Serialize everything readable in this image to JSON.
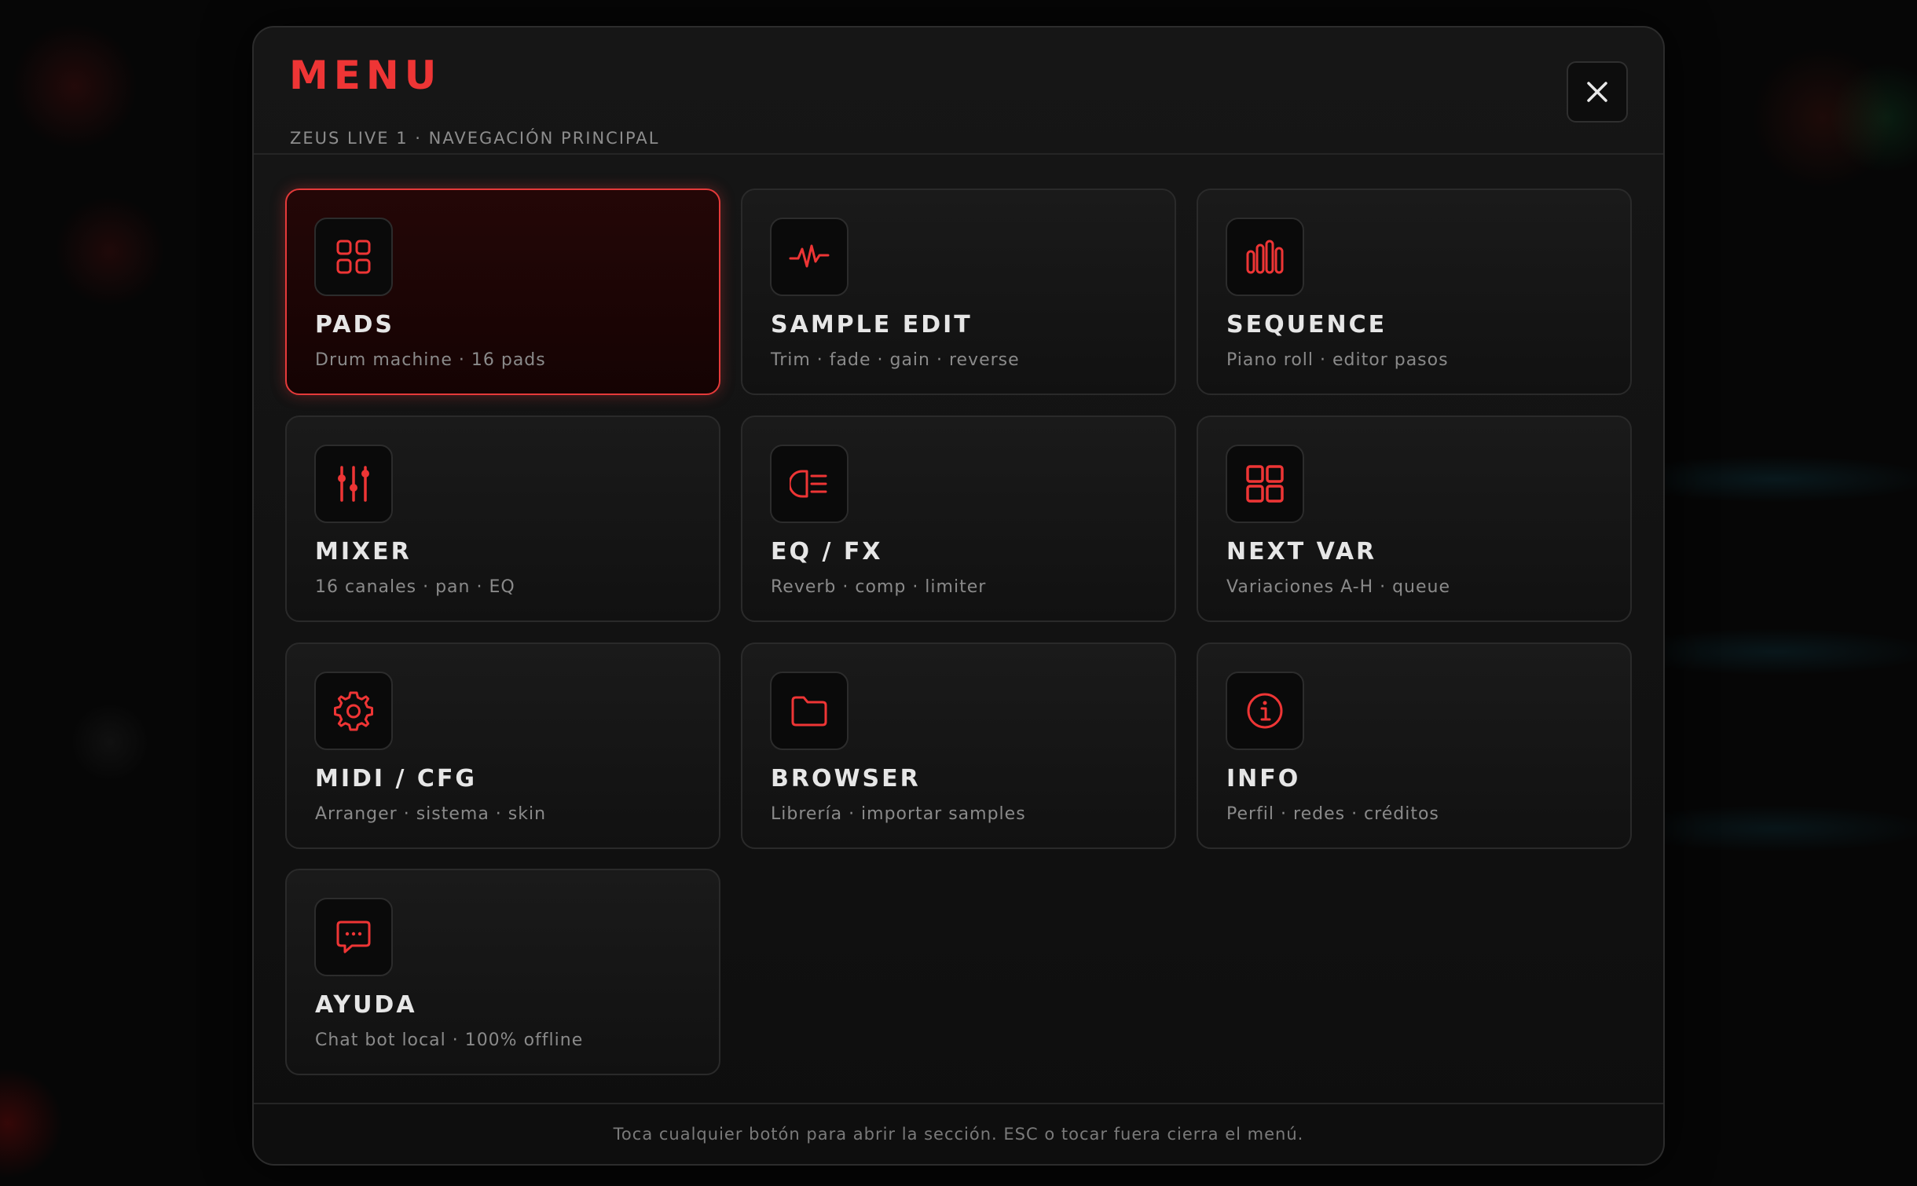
{
  "backdrop": {},
  "menu": {
    "title": "MENU",
    "subtitle": "ZEUS LIVE 1 · NAVEGACIÓN PRINCIPAL",
    "close_icon": "close-icon",
    "accent_color": "#ee3535",
    "items": [
      {
        "label": "PADS",
        "desc": "Drum machine · 16 pads",
        "icon": "grid-icon",
        "active": true
      },
      {
        "label": "SAMPLE EDIT",
        "desc": "Trim · fade · gain · reverse",
        "icon": "waveform-icon",
        "active": false
      },
      {
        "label": "SEQUENCE",
        "desc": "Piano roll · editor pasos",
        "icon": "bars-icon",
        "active": false
      },
      {
        "label": "MIXER",
        "desc": "16 canales · pan · EQ",
        "icon": "sliders-icon",
        "active": false
      },
      {
        "label": "EQ / FX",
        "desc": "Reverb · comp · limiter",
        "icon": "eq-fx-icon",
        "active": false
      },
      {
        "label": "NEXT VAR",
        "desc": "Variaciones A-H · queue",
        "icon": "layout-grid-icon",
        "active": false
      },
      {
        "label": "MIDI / CFG",
        "desc": "Arranger · sistema · skin",
        "icon": "gear-icon",
        "active": false
      },
      {
        "label": "BROWSER",
        "desc": "Librería · importar samples",
        "icon": "folder-icon",
        "active": false
      },
      {
        "label": "INFO",
        "desc": "Perfil · redes · créditos",
        "icon": "info-icon",
        "active": false
      },
      {
        "label": "AYUDA",
        "desc": "Chat bot local · 100% offline",
        "icon": "chat-icon",
        "active": false
      }
    ],
    "footer_text": "Toca cualquier botón para abrir la sección. ESC o tocar fuera cierra el menú."
  }
}
